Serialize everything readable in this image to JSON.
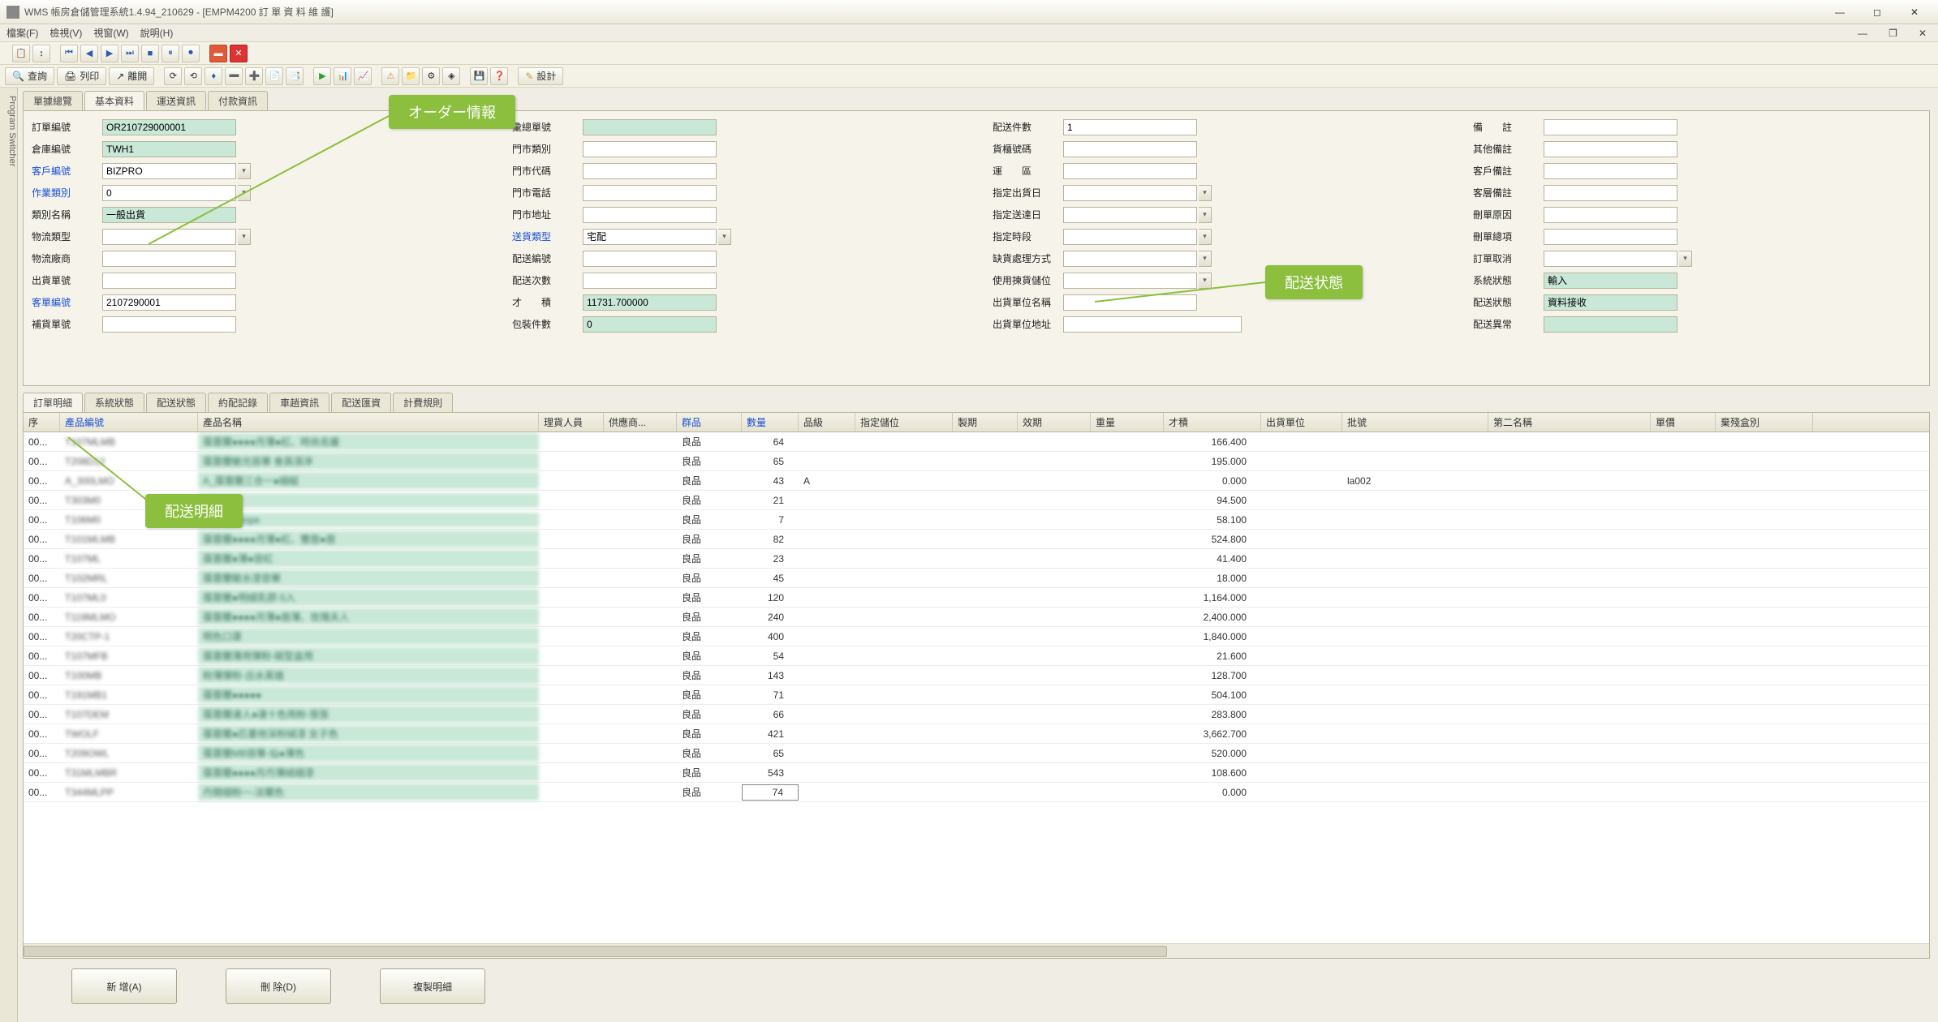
{
  "window": {
    "title": "WMS 帳房倉儲管理系統1.4.94_210629 - [EMPM4200 訂 單 資 料 維 護]"
  },
  "menu": {
    "m1": "檔案(F)",
    "m2": "檢視(V)",
    "m3": "視窗(W)",
    "m4": "說明(H)"
  },
  "toolbar2": {
    "b1": "查詢",
    "b2": "列印",
    "b3": "離開",
    "design": "設計"
  },
  "topTabs": {
    "t1": "單據總覽",
    "t2": "基本資料",
    "t3": "運送資訊",
    "t4": "付款資訊"
  },
  "callouts": {
    "orderInfo": "オーダー情報",
    "deliveryStatus": "配送状態",
    "deliveryDetail": "配送明細"
  },
  "form": {
    "c1": {
      "f1": {
        "label": "訂單編號",
        "value": "OR210729000001",
        "ro": true
      },
      "f2": {
        "label": "倉庫編號",
        "value": "TWH1",
        "ro": true
      },
      "f3": {
        "label": "客戶編號",
        "value": "BIZPRO",
        "link": true,
        "combo": true
      },
      "f4": {
        "label": "作業類別",
        "value": "0",
        "link": true,
        "combo": true
      },
      "f5": {
        "label": "類別名稱",
        "value": "一般出貨",
        "ro": true
      },
      "f6": {
        "label": "物流類型",
        "value": "",
        "combo": true
      },
      "f7": {
        "label": "物流廠商",
        "value": ""
      },
      "f8": {
        "label": "出貨單號",
        "value": ""
      },
      "f9": {
        "label": "客單編號",
        "value": "2107290001",
        "link": true
      },
      "f10": {
        "label": "補貨單號",
        "value": ""
      }
    },
    "c2": {
      "f1": {
        "label": "彙總單號",
        "value": "",
        "ro": true
      },
      "f2": {
        "label": "門市類別",
        "value": ""
      },
      "f3": {
        "label": "門市代碼",
        "value": ""
      },
      "f4": {
        "label": "門市電話",
        "value": ""
      },
      "f5": {
        "label": "門市地址",
        "value": ""
      },
      "f6": {
        "label": "送貨類型",
        "value": "宅配",
        "link": true,
        "combo": true
      },
      "f7": {
        "label": "配送編號",
        "value": ""
      },
      "f8": {
        "label": "配送次數",
        "value": ""
      },
      "f9": {
        "label": "才　　積",
        "value": "11731.700000",
        "ro": true
      },
      "f10": {
        "label": "包裝件數",
        "value": "0",
        "ro": true
      }
    },
    "c3": {
      "f1": {
        "label": "配送件數",
        "value": "1"
      },
      "f2": {
        "label": "貨櫃號碼",
        "value": ""
      },
      "f3": {
        "label": "運　　區",
        "value": ""
      },
      "f4": {
        "label": "指定出貨日",
        "value": "",
        "combo": true
      },
      "f5": {
        "label": "指定送達日",
        "value": "",
        "combo": true
      },
      "f6": {
        "label": "指定時段",
        "value": "",
        "combo": true
      },
      "f7": {
        "label": "缺貨處理方式",
        "value": "",
        "combo": true
      },
      "f8": {
        "label": "使用揀貨儲位",
        "value": "",
        "combo": true
      },
      "f9": {
        "label": "出貨單位名稱",
        "value": ""
      },
      "f10": {
        "label": "出貨單位地址",
        "value": "",
        "wide": true
      }
    },
    "c4": {
      "f1": {
        "label": "備　　註",
        "value": ""
      },
      "f2": {
        "label": "其他備註",
        "value": ""
      },
      "f3": {
        "label": "客戶備註",
        "value": ""
      },
      "f4": {
        "label": "客層備註",
        "value": ""
      },
      "f5": {
        "label": "刪單原因",
        "value": ""
      },
      "f6": {
        "label": "刪單總項",
        "value": ""
      },
      "f7": {
        "label": "訂單取消",
        "value": "",
        "combo": true,
        "small": true
      },
      "f8": {
        "label": "系統狀態",
        "value": "輸入",
        "ro": true,
        "small": true
      },
      "f9": {
        "label": "配送狀態",
        "value": "資料接收",
        "ro": true,
        "small": true
      },
      "f10": {
        "label": "配送異常",
        "value": "",
        "ro": true,
        "small": true
      }
    }
  },
  "detailTabs": {
    "t1": "訂單明細",
    "t2": "系統狀態",
    "t3": "配送狀態",
    "t4": "約配記錄",
    "t5": "車趟資訊",
    "t6": "配送匯資",
    "t7": "計費規則"
  },
  "gridHeaders": {
    "seq": "序",
    "code": "產品編號",
    "name": "產品名稱",
    "h1": "理貨人員",
    "sup": "供應商...",
    "grp": "群品",
    "qty": "數量",
    "grade": "品級",
    "loc": "指定儲位",
    "mfg": "製期",
    "exp": "效期",
    "wt": "重量",
    "vol": "才積",
    "uom": "出貨單位",
    "lot": "批號",
    "nm2": "第二名稱",
    "price": "單價",
    "bin": "棄殘盒別"
  },
  "rows": [
    {
      "seq": "00...",
      "code": "T107MLMB",
      "name": "葆蓉蘭●●●●月薄●紅、時尚名媛",
      "grp": "良品",
      "qty": "64",
      "vol": "166.400",
      "lot": ""
    },
    {
      "seq": "00...",
      "code": "T208D12",
      "name": "葆蓉蘭敏光容華 會員漲淨",
      "grp": "良品",
      "qty": "65",
      "vol": "195.000",
      "lot": ""
    },
    {
      "seq": "00...",
      "code": "A_300LMO",
      "name": "A_葆蓉蘭三合一●細組",
      "grp": "良品",
      "qty": "43",
      "grade": "A",
      "vol": "0.000",
      "lot": "la002"
    },
    {
      "seq": "00...",
      "code": "T303M0",
      "name": "●●●●",
      "grp": "良品",
      "qty": "21",
      "vol": "94.500",
      "lot": ""
    },
    {
      "seq": "00...",
      "code": "T106M0",
      "name": "●●●●●●hope",
      "grp": "良品",
      "qty": "7",
      "vol": "58.100",
      "lot": ""
    },
    {
      "seq": "00...",
      "code": "T101MLMB",
      "name": "葆蓉蘭●●●●月薄●紅、雙唇●唇",
      "grp": "良品",
      "qty": "82",
      "vol": "524.800",
      "lot": ""
    },
    {
      "seq": "00...",
      "code": "T107ML",
      "name": "葆蓉蘭●薄●容紅",
      "grp": "良品",
      "qty": "23",
      "vol": "41.400",
      "lot": ""
    },
    {
      "seq": "00...",
      "code": "T102MRL",
      "name": "葆蓉蘭敏水漆容華",
      "grp": "良品",
      "qty": "45",
      "vol": "18.000",
      "lot": ""
    },
    {
      "seq": "00...",
      "code": "T107ML0",
      "name": "葆蓉蘭●明細乳膠-5入",
      "grp": "良品",
      "qty": "120",
      "vol": "1,164.000",
      "lot": ""
    },
    {
      "seq": "00...",
      "code": "T119MLMO",
      "name": "葆蓉蘭●●●●月薄●唇薄、玫瑰夫人",
      "grp": "良品",
      "qty": "240",
      "vol": "2,400.000",
      "lot": ""
    },
    {
      "seq": "00...",
      "code": "T20CTP-1",
      "name": "明色口罩",
      "grp": "良品",
      "qty": "400",
      "vol": "1,840.000",
      "lot": ""
    },
    {
      "seq": "00...",
      "code": "T107MFB",
      "name": "葆蓉蘭薄用彈粉-碗型盒用",
      "grp": "良品",
      "qty": "54",
      "vol": "21.600",
      "lot": ""
    },
    {
      "seq": "00...",
      "code": "T100MB",
      "name": "粉薄彈粉-出水英雄",
      "grp": "良品",
      "qty": "143",
      "vol": "128.700",
      "lot": ""
    },
    {
      "seq": "00...",
      "code": "T191MB1",
      "name": "葆蓉蘭●●●●●",
      "grp": "良品",
      "qty": "71",
      "vol": "504.100",
      "lot": ""
    },
    {
      "seq": "00...",
      "code": "T107DEM",
      "name": "葆蓉蘭達人●達十色用粉-張張",
      "grp": "良品",
      "qty": "66",
      "vol": "283.800",
      "lot": ""
    },
    {
      "seq": "00...",
      "code": "TWOLF",
      "name": "葆蓉蘭●匹重他深粉絨漆 女子色",
      "grp": "良品",
      "qty": "421",
      "vol": "3,662.700",
      "lot": ""
    },
    {
      "seq": "00...",
      "code": "T209OWL",
      "name": "葆蓉蘭MB容華-仙●薄色",
      "grp": "良品",
      "qty": "65",
      "vol": "520.000",
      "lot": ""
    },
    {
      "seq": "00...",
      "code": "T31MLMBR",
      "name": "葆蓉蘭●●●●月丹薄絨細漆",
      "grp": "良品",
      "qty": "543",
      "vol": "108.600",
      "lot": ""
    },
    {
      "seq": "00...",
      "code": "T344MLPP",
      "name": "丹開細粉一-淡蘭色",
      "grp": "良品",
      "qty": "74",
      "vol": "0.000",
      "lot": ""
    }
  ],
  "bottomBtns": {
    "b1": "新  增(A)",
    "b2": "刪  除(D)",
    "b3": "複製明細"
  }
}
